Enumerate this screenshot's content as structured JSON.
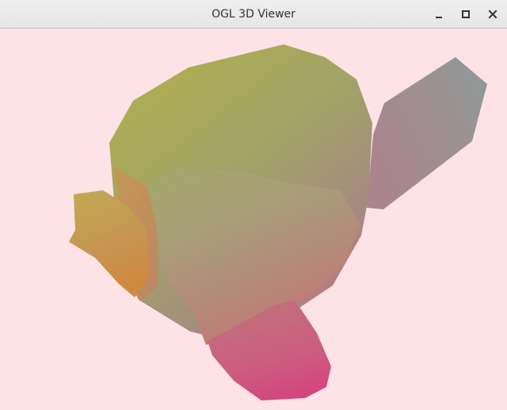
{
  "window": {
    "title": "OGL 3D Viewer",
    "controls": {
      "minimize_icon": "minimize-icon",
      "maximize_icon": "maximize-icon",
      "close_icon": "close-icon"
    }
  },
  "viewport": {
    "background_color": "#fee3e6",
    "model": "monkey-head",
    "gradient_colors": {
      "orange": "#d58c3c",
      "olive": "#a4ae58",
      "grey_blue": "#959a9e",
      "pink": "#d0527e"
    }
  }
}
